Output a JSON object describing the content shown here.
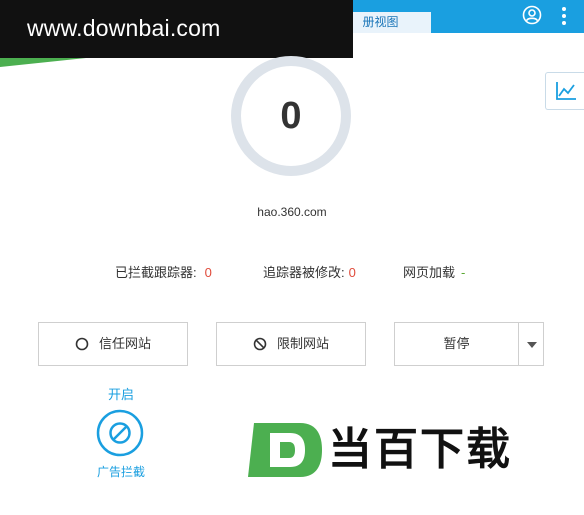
{
  "watermark": {
    "url": "www.downbai.com"
  },
  "header": {
    "tab_label": "册视图"
  },
  "gauge": {
    "value": "0"
  },
  "site": {
    "url": "hao.360.com"
  },
  "stats": {
    "trackers_blocked_label": "已拦截跟踪器:",
    "trackers_blocked_value": "0",
    "trackers_modified_label": "追踪器被修改:",
    "trackers_modified_value": "0",
    "page_load_label": "网页加载",
    "page_load_value": "-"
  },
  "buttons": {
    "trust_site": "信任网站",
    "restrict_site": "限制网站",
    "pause": "暂停"
  },
  "ad_block": {
    "status": "开启",
    "label": "广告拦截"
  },
  "logo": {
    "text": "当百下载"
  },
  "colors": {
    "accent": "#1a9fe0",
    "stat_red": "#e04b3b",
    "logo_green": "#4caf50"
  }
}
